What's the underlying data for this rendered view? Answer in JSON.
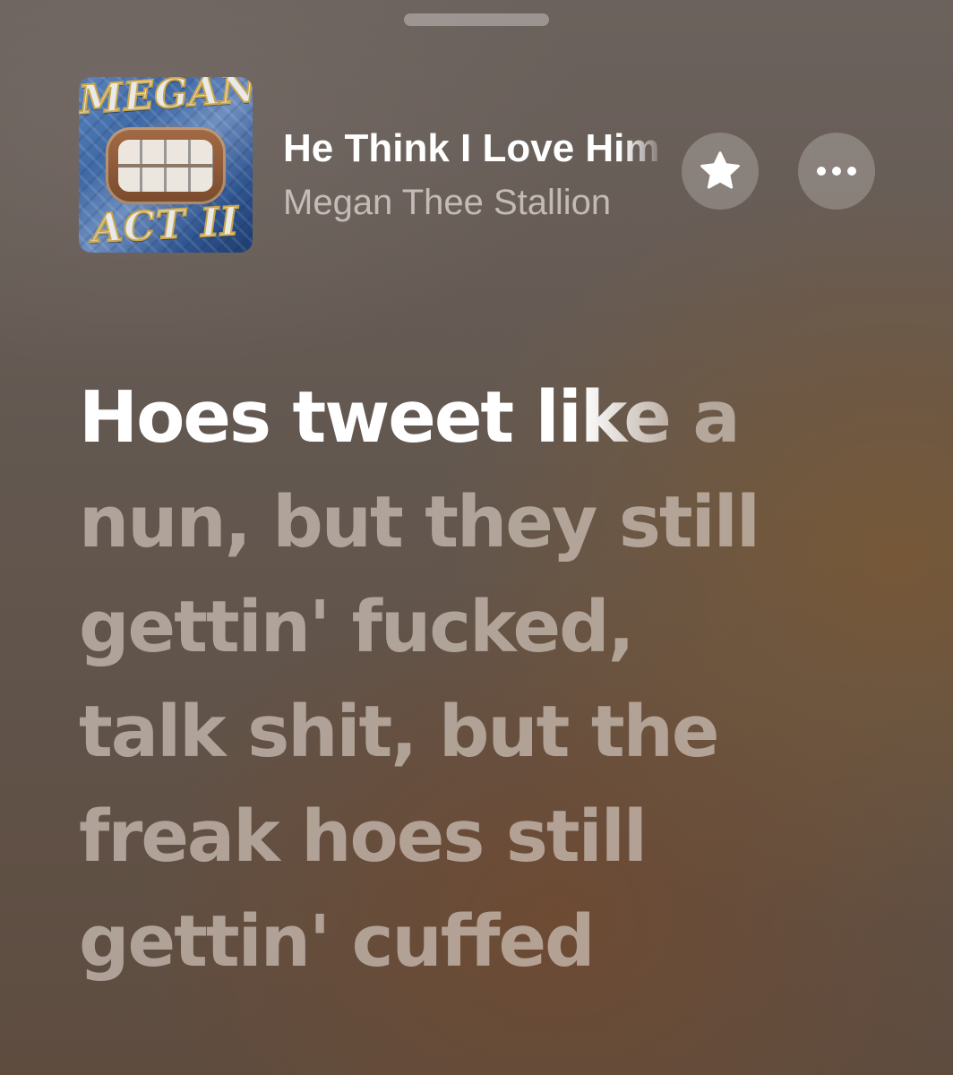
{
  "now_playing": {
    "title": "He Think I Love Him",
    "artist": "Megan Thee Stallion",
    "artwork": {
      "name": "album-artwork",
      "lettering_top": "MEGAN",
      "lettering_bottom": "ACT II"
    }
  },
  "controls": {
    "favorite_icon": "star-icon",
    "more_icon": "ellipsis-icon"
  },
  "lyrics": {
    "active_line_sung": "Hoes tweet li",
    "active_line_unsung": "ke a",
    "lines": [
      "nun, but they still",
      "gettin' fucked,",
      "talk shit, but the",
      "freak hoes still",
      "gettin' cuffed"
    ]
  },
  "colors": {
    "background_top": "#6c625d",
    "background_bottom": "#5e4c3f",
    "accent_warm": "#7a5834",
    "lyric_active": "#ffffff",
    "lyric_dim": "#cec2b8"
  }
}
